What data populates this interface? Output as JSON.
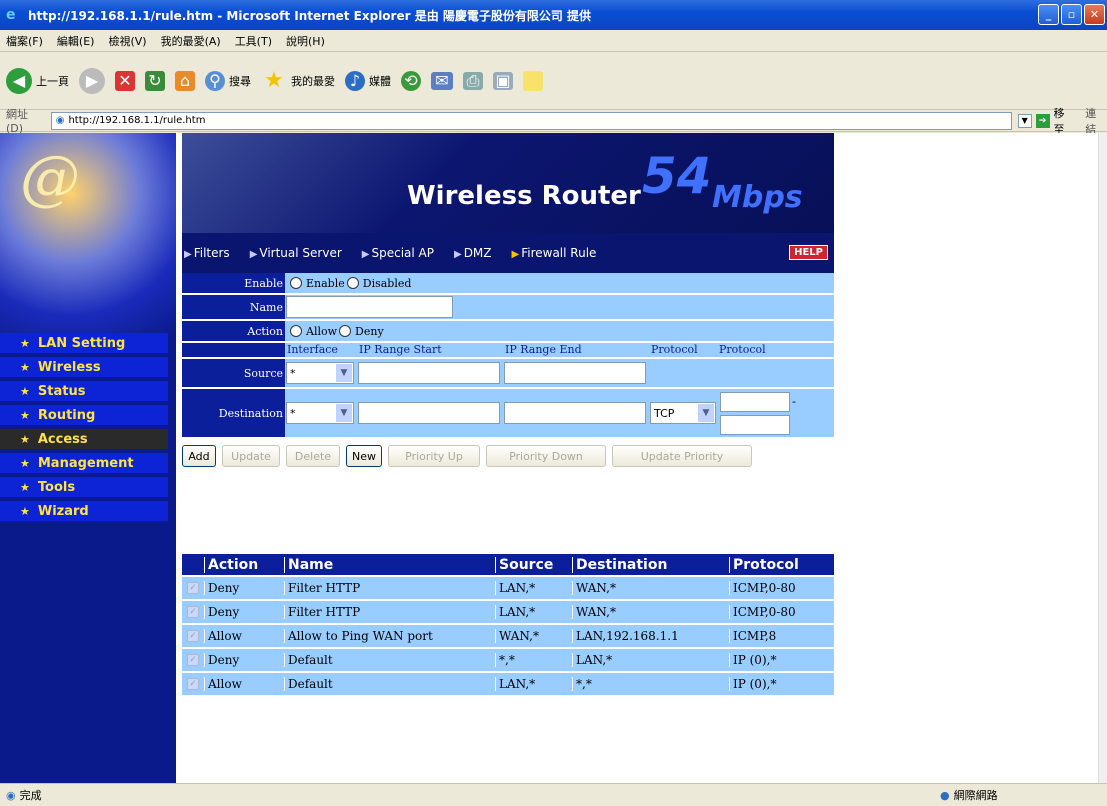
{
  "window": {
    "title": "http://192.168.1.1/rule.htm - Microsoft Internet Explorer 是由 陽慶電子股份有限公司 提供"
  },
  "menubar": [
    "檔案(F)",
    "編輯(E)",
    "檢視(V)",
    "我的最愛(A)",
    "工具(T)",
    "說明(H)"
  ],
  "toolbar": {
    "back_label": "上一頁",
    "search_label": "搜尋",
    "favorites_label": "我的最愛",
    "media_label": "媒體"
  },
  "address": {
    "label": "網址(D)",
    "url": "http://192.168.1.1/rule.htm",
    "go_label": "移至",
    "links_label": "連結"
  },
  "sidebar": {
    "items": [
      {
        "label": "LAN Setting"
      },
      {
        "label": "Wireless"
      },
      {
        "label": "Status"
      },
      {
        "label": "Routing"
      },
      {
        "label": "Access"
      },
      {
        "label": "Management"
      },
      {
        "label": "Tools"
      },
      {
        "label": "Wizard"
      }
    ]
  },
  "banner": {
    "title": "Wireless Router",
    "speed": "54",
    "unit": "Mbps"
  },
  "tabs": [
    "Filters",
    "Virtual Server",
    "Special AP",
    "DMZ",
    "Firewall Rule"
  ],
  "help_label": "HELP",
  "form": {
    "enable_label": "Enable",
    "enable_opt": "Enable",
    "disabled_opt": "Disabled",
    "name_label": "Name",
    "action_label": "Action",
    "allow_opt": "Allow",
    "deny_opt": "Deny",
    "headers": [
      "Interface",
      "IP Range Start",
      "IP Range End",
      "Protocol",
      "Protocol"
    ],
    "source_label": "Source",
    "destination_label": "Destination",
    "source_interface": "*",
    "dest_interface": "*",
    "dest_protocol": "TCP",
    "dash": "-"
  },
  "buttons": [
    "Add",
    "Update",
    "Delete",
    "New",
    "Priority Up",
    "Priority Down",
    "Update Priority"
  ],
  "rules": {
    "headers": [
      "Action",
      "Name",
      "Source",
      "Destination",
      "Protocol"
    ],
    "rows": [
      {
        "action": "Deny",
        "name": "Filter HTTP",
        "source": "LAN,*",
        "destination": "WAN,*",
        "protocol": "ICMP,0-80"
      },
      {
        "action": "Deny",
        "name": "Filter HTTP",
        "source": "LAN,*",
        "destination": "WAN,*",
        "protocol": "ICMP,0-80"
      },
      {
        "action": "Allow",
        "name": "Allow to Ping WAN port",
        "source": "WAN,*",
        "destination": "LAN,192.168.1.1",
        "protocol": "ICMP,8"
      },
      {
        "action": "Deny",
        "name": "Default",
        "source": "*,*",
        "destination": "LAN,*",
        "protocol": "IP (0),*"
      },
      {
        "action": "Allow",
        "name": "Default",
        "source": "LAN,*",
        "destination": "*,*",
        "protocol": "IP (0),*"
      }
    ]
  },
  "status": {
    "left": "完成",
    "zone": "網際網路"
  }
}
